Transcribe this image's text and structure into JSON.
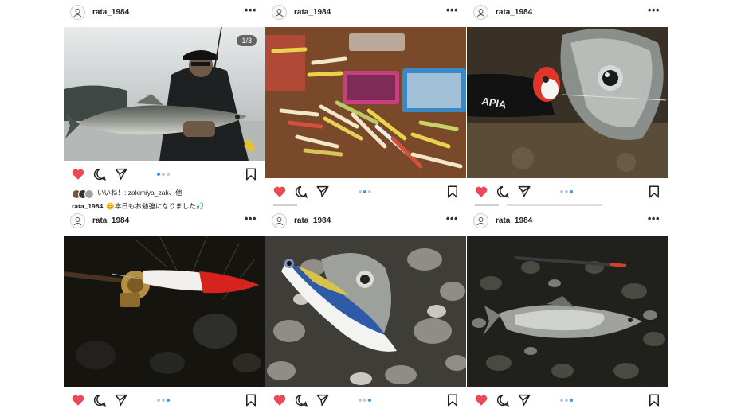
{
  "posts": [
    {
      "username": "rata_1984",
      "more_label": "•••",
      "counter": "1/3",
      "liked_by": "いいね！: zakimiya_zak、他",
      "caption_user": "rata_1984",
      "caption_text": "😊本日もお勉強になりました🎣",
      "active_dot": 1,
      "dot_count": 3
    },
    {
      "username": "rata_1984",
      "more_label": "•••",
      "active_dot": 2,
      "dot_count": 3
    },
    {
      "username": "rata_1984",
      "more_label": "•••",
      "active_dot": 3,
      "dot_count": 3
    },
    {
      "username": "rata_1984",
      "more_label": "•••",
      "active_dot": 3,
      "dot_count": 3
    },
    {
      "username": "rata_1984",
      "more_label": "•••",
      "active_dot": 3,
      "dot_count": 3
    },
    {
      "username": "rata_1984",
      "more_label": "•••",
      "active_dot": 3,
      "dot_count": 3
    }
  ],
  "lure_brand_text": "APIA",
  "colors": {
    "like_red": "#ed4956",
    "accent_blue": "#3897f0",
    "dot_grey": "#c8c8c8"
  },
  "icons": [
    "heart-icon",
    "comment-icon",
    "share-icon",
    "bookmark-icon",
    "more-options-icon",
    "avatar-icon"
  ]
}
